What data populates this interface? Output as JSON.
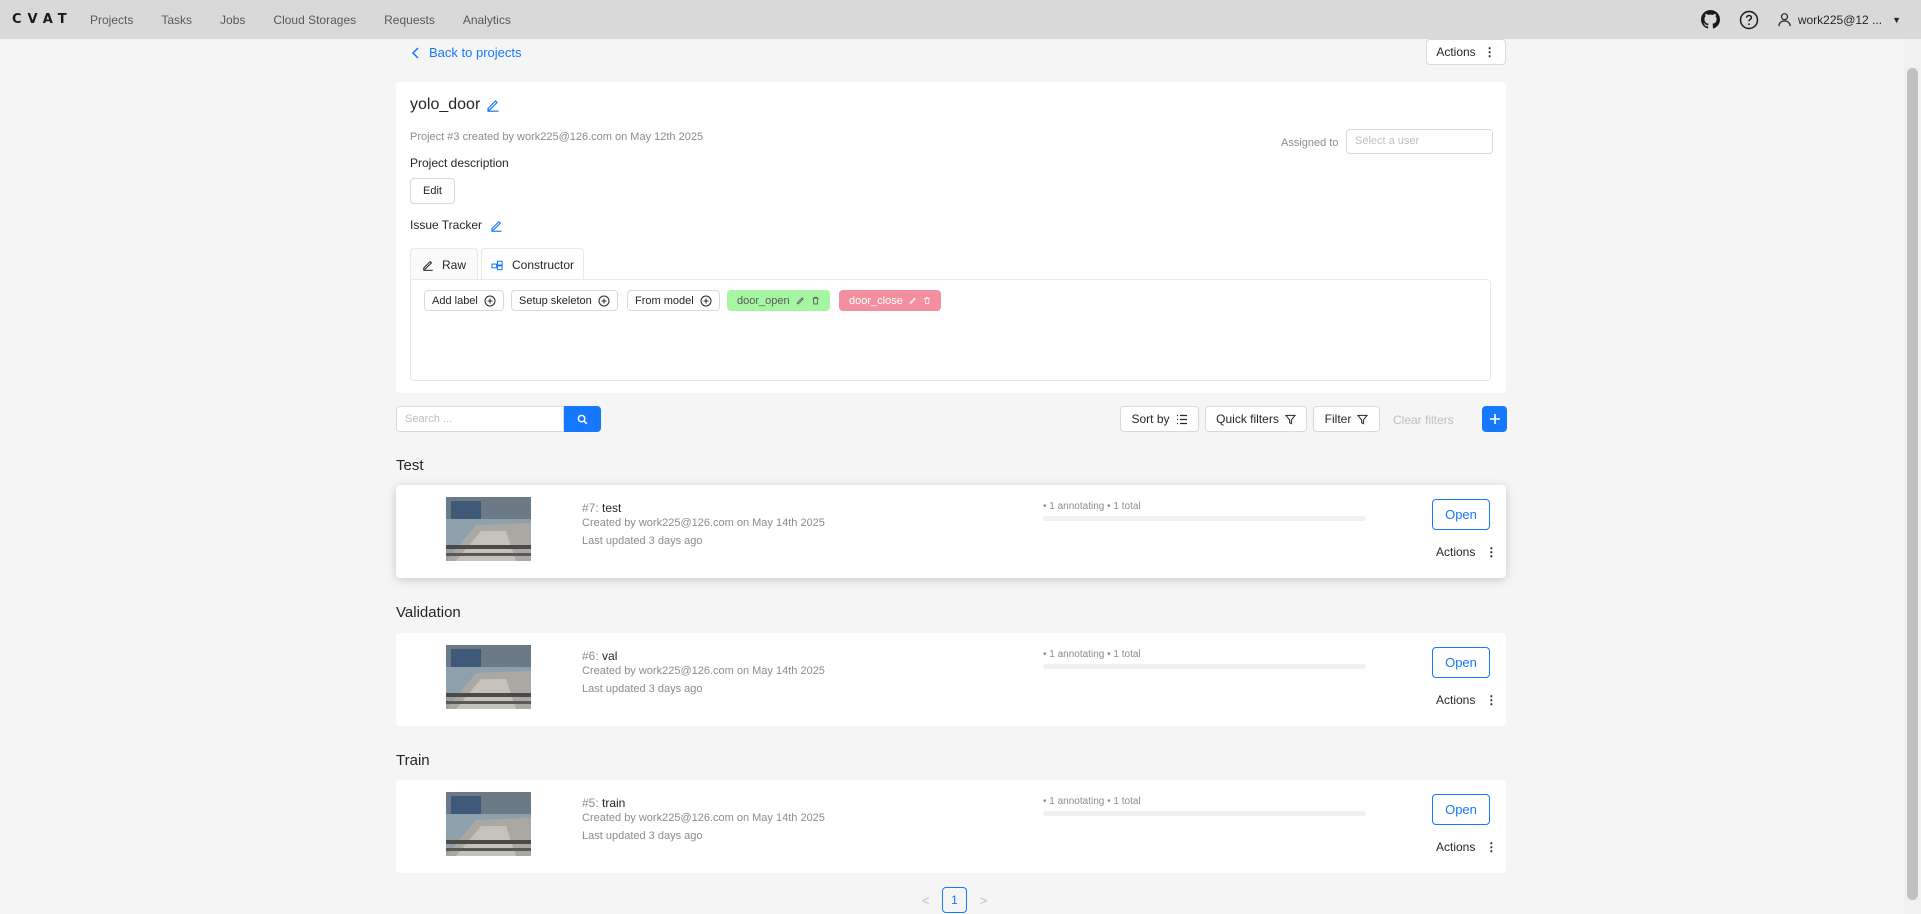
{
  "app": {
    "logo": "CVAT",
    "nav": [
      "Projects",
      "Tasks",
      "Jobs",
      "Cloud Storages",
      "Requests",
      "Analytics"
    ],
    "user": "work225@12 ..."
  },
  "page": {
    "back_label": "Back to projects",
    "actions_label": "Actions"
  },
  "project": {
    "title": "yolo_door",
    "meta": "Project #3 created by work225@126.com on May 12th 2025",
    "assigned_label": "Assigned to",
    "assigned_placeholder": "Select a user",
    "description_label": "Project description",
    "edit_label": "Edit",
    "issue_tracker_label": "Issue Tracker",
    "tabs": [
      "Raw",
      "Constructor"
    ],
    "label_buttons": [
      "Add label",
      "Setup skeleton",
      "From model"
    ],
    "labels": [
      {
        "name": "door_open",
        "color": "#a6f5a2"
      },
      {
        "name": "door_close",
        "color": "#f48fa0"
      }
    ]
  },
  "filters": {
    "search_placeholder": "Search ...",
    "sort_label": "Sort by",
    "quick_filters_label": "Quick filters",
    "filter_label": "Filter",
    "clear_label": "Clear filters"
  },
  "sections": [
    {
      "title": "Test",
      "task": {
        "id": "#7: ",
        "name": "test",
        "created": "Created by work225@126.com on May 14th 2025",
        "updated": "Last updated 3 days ago",
        "progress_text": "• 1 annotating • 1 total",
        "open_label": "Open",
        "actions_label": "Actions",
        "progress": 0
      }
    },
    {
      "title": "Validation",
      "task": {
        "id": "#6: ",
        "name": "val",
        "created": "Created by work225@126.com on May 14th 2025",
        "updated": "Last updated 3 days ago",
        "progress_text": "• 1 annotating • 1 total",
        "open_label": "Open",
        "actions_label": "Actions",
        "progress": 0
      }
    },
    {
      "title": "Train",
      "task": {
        "id": "#5: ",
        "name": "train",
        "created": "Created by work225@126.com on May 14th 2025",
        "updated": "Last updated 3 days ago",
        "progress_text": "• 1 annotating • 1 total",
        "open_label": "Open",
        "actions_label": "Actions",
        "progress": 0
      }
    }
  ],
  "pagination": {
    "current": "1",
    "prev": "<",
    "next": ">"
  }
}
